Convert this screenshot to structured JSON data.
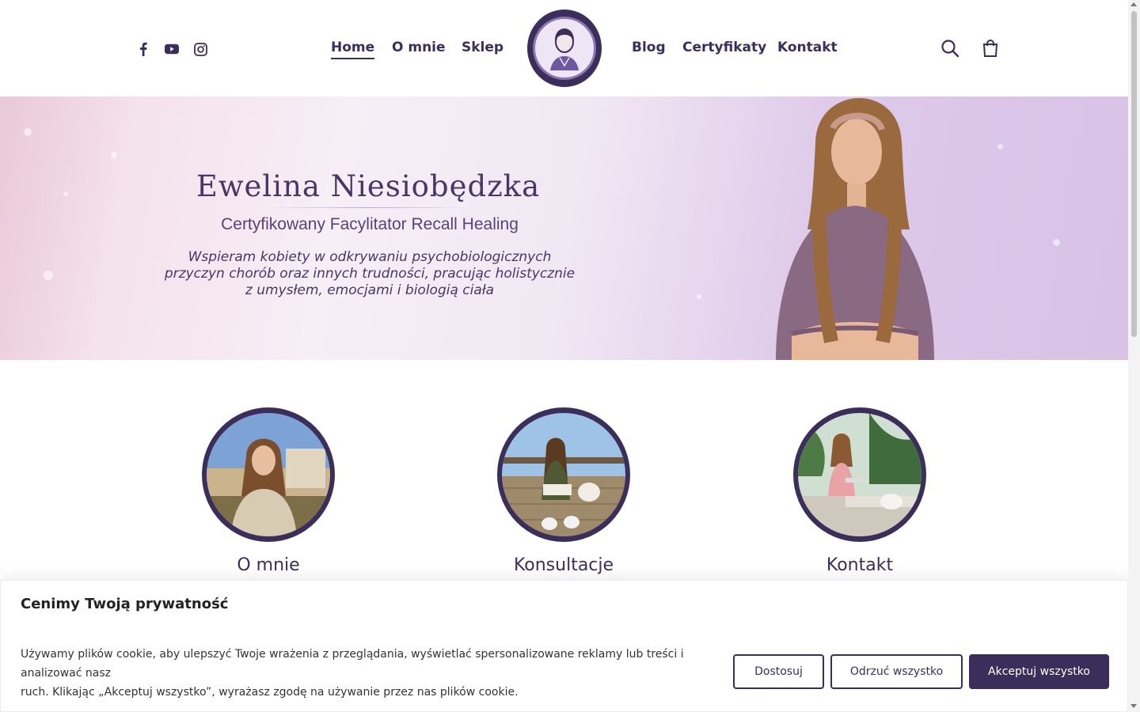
{
  "header": {
    "social": [
      {
        "icon": "facebook-icon"
      },
      {
        "icon": "youtube-icon"
      },
      {
        "icon": "instagram-icon"
      }
    ],
    "nav_left": [
      {
        "label": "Home",
        "active": true
      },
      {
        "label": "O mnie"
      },
      {
        "label": "Sklep"
      }
    ],
    "nav_right": [
      {
        "label": "Blog"
      },
      {
        "label": "Certyfikaty"
      },
      {
        "label": "Kontakt"
      }
    ],
    "logo": "site-logo",
    "icons": [
      "search-icon",
      "shopping-bag-icon"
    ]
  },
  "hero": {
    "title": "Ewelina Niesiobędzka",
    "subtitle": "Certyfikowany Facylitator Recall Healing",
    "description_lines": [
      "Wspieram kobiety w odkrywaniu psychobiologicznych",
      "przyczyn chorób oraz innych trudności, pracując holistycznie",
      "z umysłem, emocjami i biologią ciała"
    ]
  },
  "features": [
    {
      "title": "O mnie"
    },
    {
      "title": "Konsultacje"
    },
    {
      "title": "Kontakt"
    }
  ],
  "cookie": {
    "title": "Cenimy Twoją prywatność",
    "text_lines": [
      "Używamy plików cookie, aby ulepszyć Twoje wrażenia z przeglądania, wyświetlać spersonalizowane reklamy lub treści i analizować nasz",
      "ruch. Klikając „Akceptuj wszystko”, wyrażasz zgodę na używanie przez nas plików cookie."
    ],
    "customize_label": "Dostosuj",
    "reject_label": "Odrzuć wszystko",
    "accept_label": "Akceptuj wszystko"
  },
  "colors": {
    "brand": "#3b2e5a",
    "hero_text": "#4a3566"
  }
}
